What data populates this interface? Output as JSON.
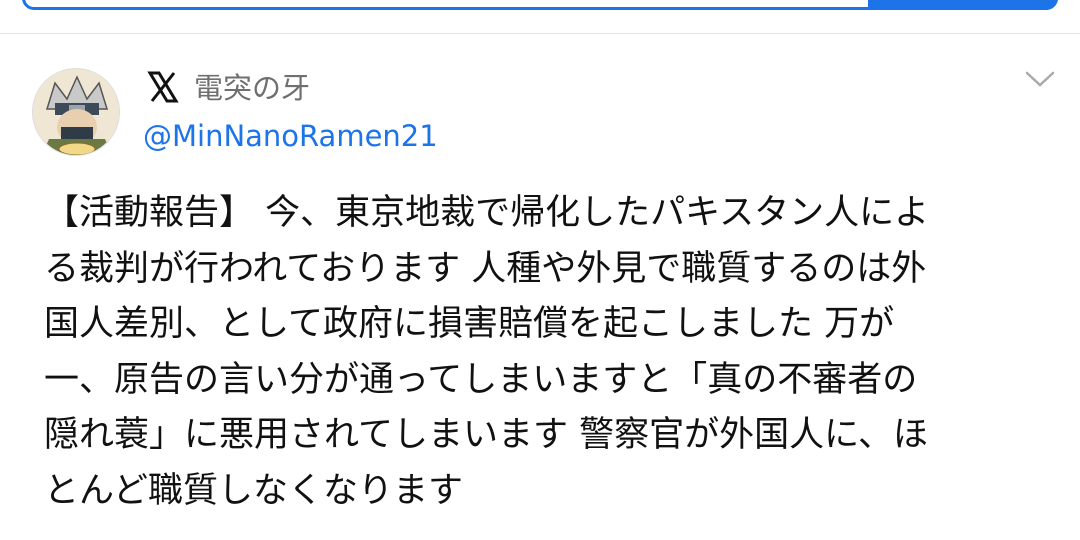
{
  "header": {
    "search_bar_color": "#1d74e8"
  },
  "tweet": {
    "platform_icon": "x-logo-icon",
    "display_name": "電突の牙",
    "handle": "@MinNanoRamen21",
    "menu_icon": "chevron-down-icon",
    "body_lines": [
      "【活動報告】 今、東京地裁で帰化したパキスタン人によ",
      "る裁判が行われております 人種や外見で職質するのは外",
      "国人差別、として政府に損害賠償を起こしました 万が",
      "一、原告の言い分が通ってしまいますと「真の不審者の",
      "隠れ蓑」に悪用されてしまいます 警察官が外国人に、ほ",
      "とんど職質しなくなります"
    ]
  },
  "colors": {
    "accent": "#1d74e8",
    "text": "#111111",
    "muted": "#6f6f6f"
  }
}
